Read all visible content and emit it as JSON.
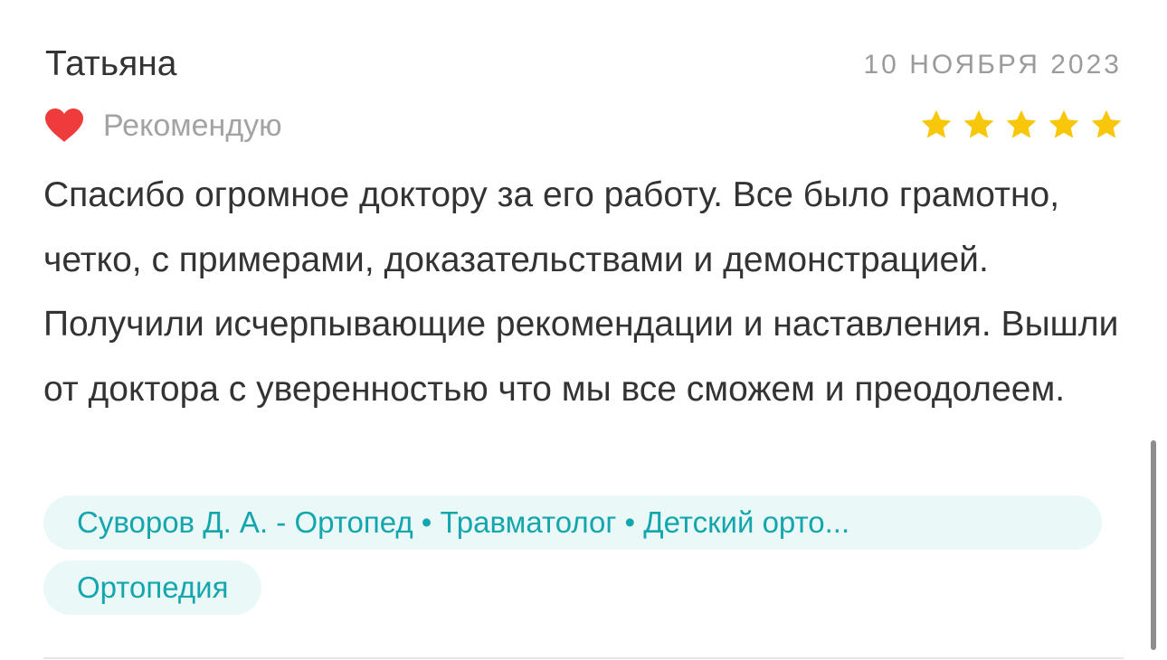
{
  "review": {
    "author": "Татьяна",
    "date": "10 НОЯБРЯ 2023",
    "recommend_label": "Рекомендую",
    "rating": 5,
    "rating_max": 5,
    "text": "Спасибо огромное доктору за его работу. Все было грамотно, четко, с примерами, доказательствами и демонстрацией. Получили исчерпывающие рекомендации и наставления. Вышли от доктора с уверенностью что мы все сможем и преодолеем.",
    "doctor_tag": "Суворов Д. А. - Ортопед • Травматолог • Детский орто...",
    "specialty_tag": "Ортопедия"
  },
  "colors": {
    "heart": "#ef3b3b",
    "star": "#f8c70a",
    "tag_background": "#eaf8f8",
    "tag_text": "#14a6ad",
    "muted_text": "#9b9b9b"
  },
  "icons": {
    "recommend": "heart-icon",
    "rating": "star-icon"
  }
}
